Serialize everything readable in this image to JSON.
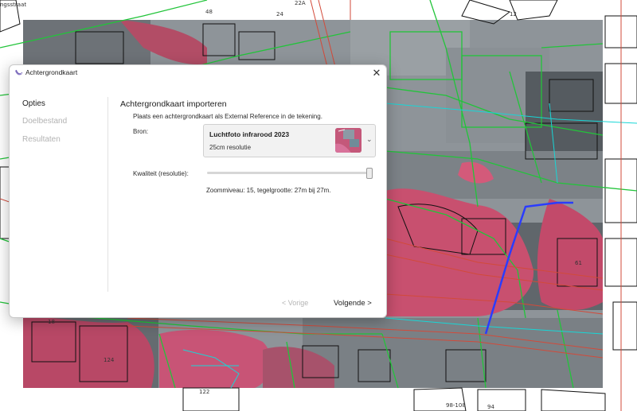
{
  "dialog": {
    "title": "Achtergrondkaart",
    "close_glyph": "✕",
    "icon": "app-swoosh-icon"
  },
  "nav": {
    "items": [
      {
        "label": "Opties",
        "state": "active"
      },
      {
        "label": "Doelbestand",
        "state": "disabled"
      },
      {
        "label": "Resultaten",
        "state": "disabled"
      }
    ]
  },
  "import": {
    "title": "Achtergrondkaart importeren",
    "description": "Plaats een achtergrondkaart als External Reference in de tekening.",
    "source": {
      "label": "Bron:",
      "selected_name": "Luchtfoto infrarood 2023",
      "selected_resolution": "25cm resolutie",
      "chevron_glyph": "⌄"
    },
    "quality": {
      "label": "Kwaliteit (resolutie):",
      "value_fraction": 1.0,
      "info": "Zoommiveau: 15, tegelgrootte: 27m bij 27m."
    }
  },
  "footer": {
    "prev_label": "< Vorige",
    "next_label": "Volgende  >"
  },
  "map": {
    "labels": [
      "48",
      "24",
      "22A",
      "ngsstraat",
      "18",
      "12",
      "124",
      "122",
      "98-108",
      "94",
      "61"
    ]
  },
  "colors": {
    "map_green": "#22c43a",
    "map_cyan": "#18d6d6",
    "map_red": "#d24a3a",
    "map_blue": "#2a3cff",
    "infrared_red": "#c8506f"
  }
}
